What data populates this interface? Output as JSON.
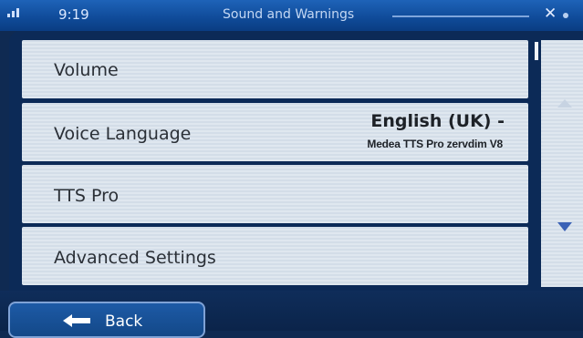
{
  "status": {
    "time": "9:19",
    "title": "Sound and Warnings"
  },
  "menu": {
    "items": [
      {
        "label": "Volume"
      },
      {
        "label": "Voice Language",
        "value": "English (UK) -",
        "sub_value": "Medea TTS Pro zervdim V8"
      },
      {
        "label": "TTS Pro"
      },
      {
        "label": "Advanced Settings"
      }
    ]
  },
  "footer": {
    "back_label": "Back"
  },
  "icons": {
    "signal": "signal-icon",
    "close": "close-icon",
    "gps": "gps-status-icon",
    "scroll_up": "scroll-up-icon",
    "scroll_down": "scroll-down-icon",
    "back": "back-arrow-icon"
  },
  "colors": {
    "accent": "#1e63b8",
    "panel": "#0c2a57",
    "row": "#dfe7ef"
  }
}
